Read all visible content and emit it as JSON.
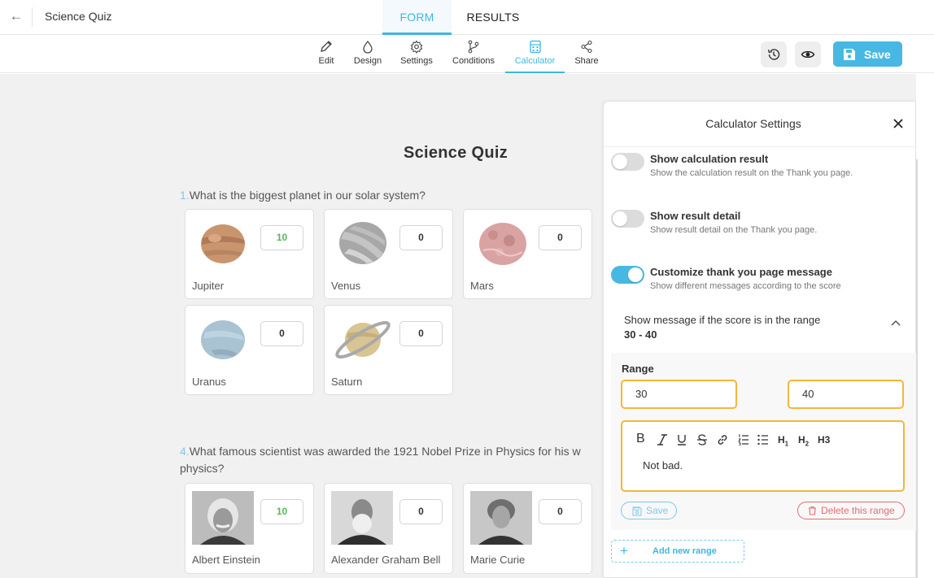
{
  "header": {
    "back_icon": "arrow-left-icon",
    "title": "Science Quiz",
    "tabs": [
      {
        "label": "FORM",
        "active": true
      },
      {
        "label": "RESULTS",
        "active": false
      }
    ]
  },
  "toolbar": {
    "tools": [
      {
        "label": "Edit",
        "icon": "pencil-icon"
      },
      {
        "label": "Design",
        "icon": "droplet-icon"
      },
      {
        "label": "Settings",
        "icon": "gear-icon"
      },
      {
        "label": "Conditions",
        "icon": "branch-icon"
      },
      {
        "label": "Calculator",
        "icon": "calculator-icon",
        "active": true
      },
      {
        "label": "Share",
        "icon": "share-icon"
      }
    ],
    "history_icon": "history-icon",
    "preview_icon": "eye-icon",
    "save_label": "Save",
    "accent": "#47b8e3"
  },
  "form": {
    "title": "Science Quiz",
    "questions": [
      {
        "number": "1.",
        "text": "What is the biggest planet in our solar system?",
        "options": [
          {
            "label": "Jupiter",
            "score": "10"
          },
          {
            "label": "Venus",
            "score": "0"
          },
          {
            "label": "Mars",
            "score": "0"
          },
          {
            "label": "Uranus",
            "score": "0"
          },
          {
            "label": "Saturn",
            "score": "0"
          }
        ]
      },
      {
        "number": "4.",
        "text": "What famous scientist was awarded the 1921 Nobel Prize in Physics for his w",
        "text_line2": "physics?",
        "options": [
          {
            "label": "Albert Einstein",
            "score": "10"
          },
          {
            "label": "Alexander Graham Bell",
            "score": "0"
          },
          {
            "label": "Marie Curie",
            "score": "0"
          }
        ]
      }
    ]
  },
  "panel": {
    "title": "Calculator Settings",
    "options": [
      {
        "title": "Show calculation result",
        "desc": "Show the calculation result on the Thank you page.",
        "on": false
      },
      {
        "title": "Show result detail",
        "desc": "Show result detail on the Thank you page.",
        "on": false
      },
      {
        "title": "Customize thank you page message",
        "desc": "Show different messages according to the score",
        "on": true
      }
    ],
    "range_heading": "Show message if the score is in the range",
    "range_value": "30 - 40",
    "range_label": "Range",
    "range_min": "30",
    "range_max": "40",
    "editor_tools": [
      "B",
      "I",
      "U",
      "S",
      "link",
      "ol",
      "ul",
      "H1",
      "H2",
      "H3"
    ],
    "editor_text": "Not bad.",
    "save_label": "Save",
    "delete_label": "Delete this range",
    "add_label": "Add new range",
    "warning_border": "#f5b63b",
    "danger": "#e46b6b"
  }
}
